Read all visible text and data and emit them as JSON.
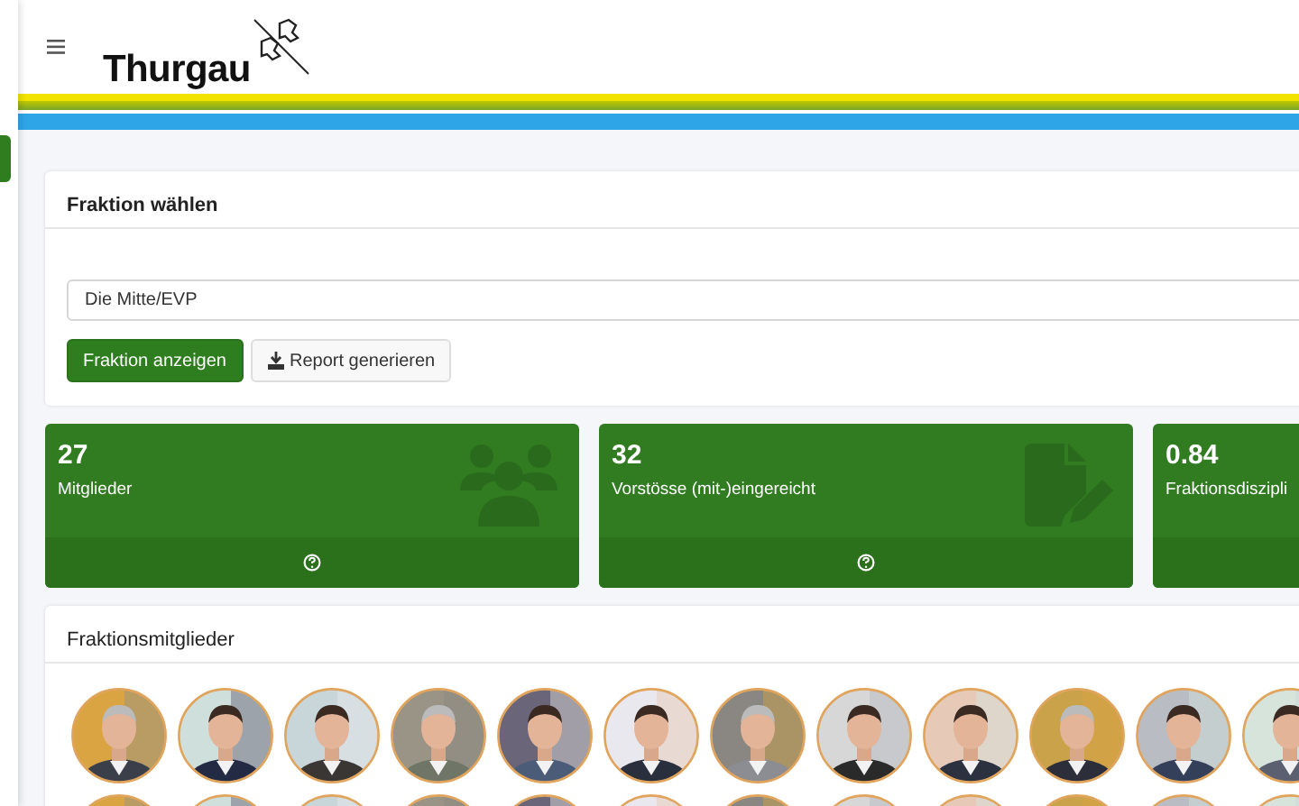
{
  "header": {
    "logo_text": "Thurgau"
  },
  "select_card": {
    "title": "Fraktion wählen",
    "select_value": "Die Mitte/EVP",
    "buttons": [
      {
        "label": "Fraktion anzeigen",
        "kind": "primary"
      },
      {
        "label": "Report generieren",
        "kind": "download"
      }
    ]
  },
  "stats": [
    {
      "value": "27",
      "label": "Mitglieder",
      "kind": "people"
    },
    {
      "value": "32",
      "label": "Vorstösse (mit-)eingereicht",
      "kind": "document"
    },
    {
      "value": "0.84",
      "label": "Fraktionsdiszipli",
      "kind": "ratio"
    }
  ],
  "members_card": {
    "title": "Fraktionsmitglieder"
  }
}
